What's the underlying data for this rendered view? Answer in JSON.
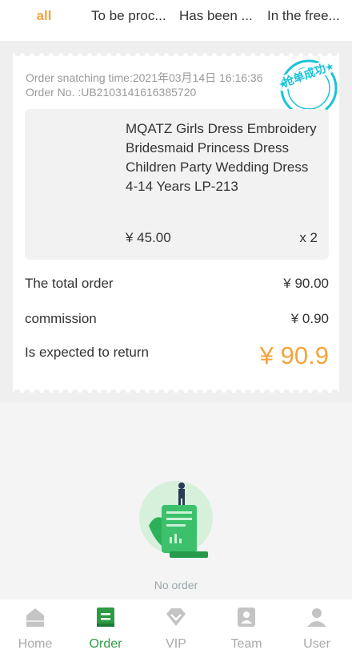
{
  "tabs": [
    {
      "label": "all"
    },
    {
      "label": "To be proc..."
    },
    {
      "label": "Has been ..."
    },
    {
      "label": "In the free..."
    }
  ],
  "order": {
    "time_label": "Order snatching time:2021年03月14日 16:16:36",
    "order_no": "Order No. :UB2103141616385720",
    "stamp_text": "抢单成功",
    "product_name": "MQATZ Girls Dress Embroidery Bridesmaid Princess Dress Children Party Wedding Dress 4-14 Years LP-213",
    "price": "¥ 45.00",
    "qty": "x 2",
    "total_label": "The total order",
    "total_value": "¥ 90.00",
    "commission_label": "commission",
    "commission_value": "¥ 0.90",
    "expected_label": "Is expected to return",
    "expected_value": "¥ 90.9"
  },
  "empty": {
    "text": "No order"
  },
  "nav": [
    {
      "label": "Home",
      "icon": "home-icon"
    },
    {
      "label": "Order",
      "icon": "order-icon"
    },
    {
      "label": "VIP",
      "icon": "diamond-icon"
    },
    {
      "label": "Team",
      "icon": "team-icon"
    },
    {
      "label": "User",
      "icon": "user-icon"
    }
  ],
  "colors": {
    "accent": "#f7a33a",
    "nav_active": "#2e9a42",
    "stamp": "#19c3d8"
  }
}
